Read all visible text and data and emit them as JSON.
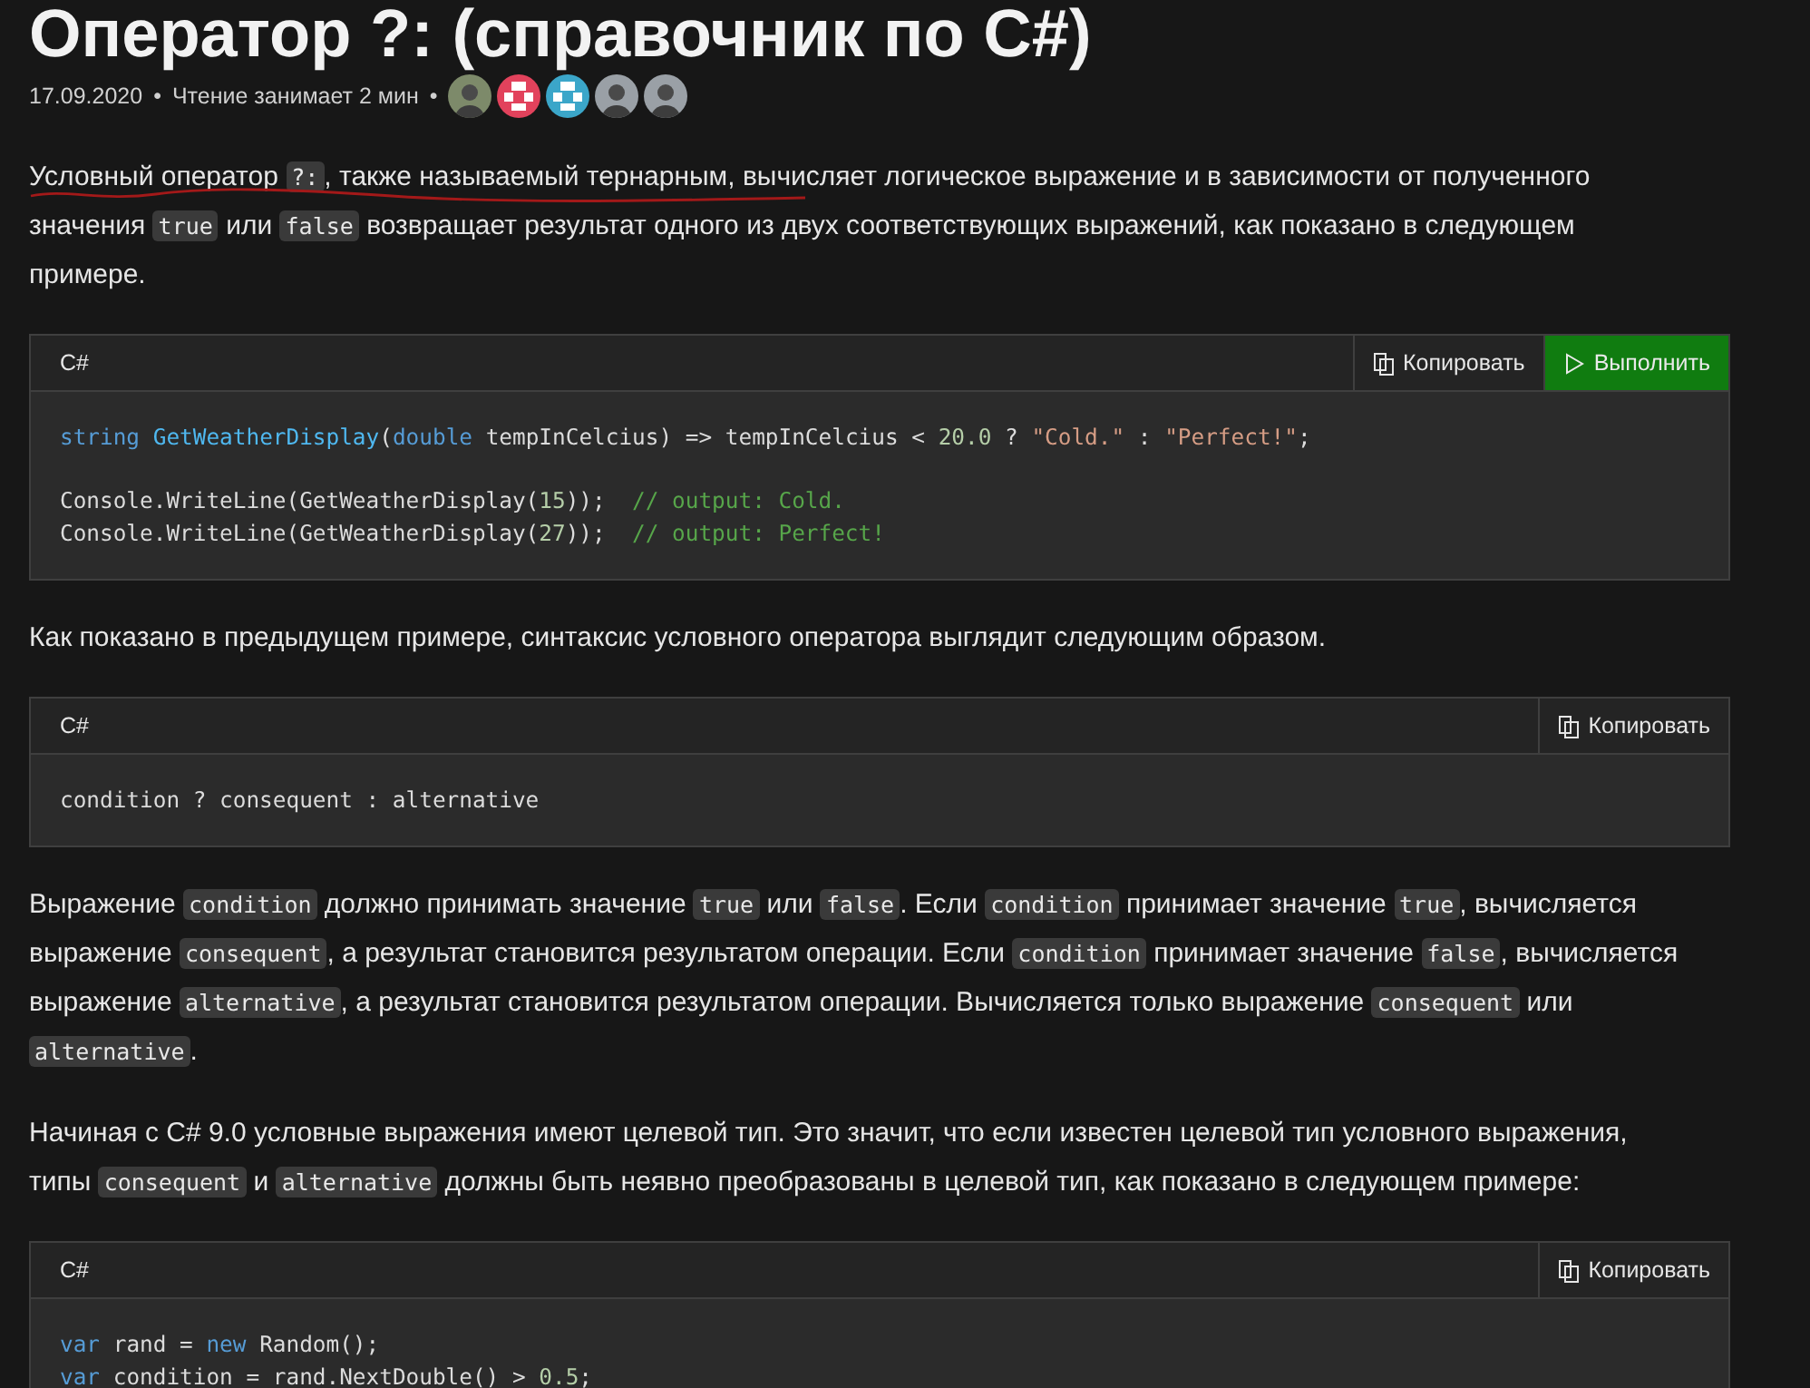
{
  "title": "Оператор ?: (справочник по C#)",
  "meta": {
    "date": "17.09.2020",
    "separator": "•",
    "reading_time": "Чтение занимает 2 мин",
    "separator_2": "•",
    "avatars": [
      {
        "kind": "photo"
      },
      {
        "kind": "identicon",
        "color": "#e2425c"
      },
      {
        "kind": "identicon",
        "color": "#3ba6c9"
      },
      {
        "kind": "photo"
      },
      {
        "kind": "photo"
      }
    ]
  },
  "content": [
    {
      "kind": "paragraph",
      "underlined": true,
      "segments": [
        {
          "kind": "text",
          "text": "Условный оператор "
        },
        {
          "kind": "code",
          "text": "?:"
        },
        {
          "kind": "text",
          "text": ", также называемый тернарным, вычисляет логическое выражение и в зависимости от полученного значения "
        },
        {
          "kind": "code",
          "text": "true"
        },
        {
          "kind": "text",
          "text": " или "
        },
        {
          "kind": "code",
          "text": "false"
        },
        {
          "kind": "text",
          "text": " возвращает результат одного из двух соответствующих выражений, как показано в следующем примере."
        }
      ]
    },
    {
      "kind": "code_block",
      "language": "C#",
      "buttons": [
        {
          "kind": "copy",
          "label": "Копировать"
        },
        {
          "kind": "run",
          "label": "Выполнить"
        }
      ],
      "groups": [
        [
          [
            {
              "kind": "keyword",
              "text": "string "
            },
            {
              "kind": "function",
              "text": "GetWeatherDisplay"
            },
            {
              "kind": "plain",
              "text": "("
            },
            {
              "kind": "keyword",
              "text": "double"
            },
            {
              "kind": "plain",
              "text": " tempInCelcius) => tempInCelcius < "
            },
            {
              "kind": "number",
              "text": "20.0"
            },
            {
              "kind": "plain",
              "text": " ? "
            },
            {
              "kind": "string",
              "text": "\"Cold.\""
            },
            {
              "kind": "plain",
              "text": " : "
            },
            {
              "kind": "string",
              "text": "\"Perfect!\""
            },
            {
              "kind": "plain",
              "text": ";"
            }
          ]
        ],
        [
          [
            {
              "kind": "plain",
              "text": "Console.WriteLine(GetWeatherDisplay("
            },
            {
              "kind": "number",
              "text": "15"
            },
            {
              "kind": "plain",
              "text": "));  "
            },
            {
              "kind": "comment",
              "text": "// output: Cold."
            }
          ],
          [
            {
              "kind": "plain",
              "text": "Console.WriteLine(GetWeatherDisplay("
            },
            {
              "kind": "number",
              "text": "27"
            },
            {
              "kind": "plain",
              "text": "));  "
            },
            {
              "kind": "comment",
              "text": "// output: Perfect!"
            }
          ]
        ]
      ]
    },
    {
      "kind": "paragraph",
      "underlined": false,
      "segments": [
        {
          "kind": "text",
          "text": "Как показано в предыдущем примере, синтаксис условного оператора выглядит следующим образом."
        }
      ]
    },
    {
      "kind": "code_block",
      "language": "C#",
      "buttons": [
        {
          "kind": "copy",
          "label": "Копировать"
        }
      ],
      "groups": [
        [
          [
            {
              "kind": "plain",
              "text": "condition ? consequent : alternative"
            }
          ]
        ]
      ]
    },
    {
      "kind": "paragraph",
      "underlined": false,
      "segments": [
        {
          "kind": "text",
          "text": "Выражение "
        },
        {
          "kind": "code",
          "text": "condition"
        },
        {
          "kind": "text",
          "text": " должно принимать значение "
        },
        {
          "kind": "code",
          "text": "true"
        },
        {
          "kind": "text",
          "text": " или "
        },
        {
          "kind": "code",
          "text": "false"
        },
        {
          "kind": "text",
          "text": ". Если "
        },
        {
          "kind": "code",
          "text": "condition"
        },
        {
          "kind": "text",
          "text": " принимает значение "
        },
        {
          "kind": "code",
          "text": "true"
        },
        {
          "kind": "text",
          "text": ", вычисляется выражение "
        },
        {
          "kind": "code",
          "text": "consequent"
        },
        {
          "kind": "text",
          "text": ", а результат становится результатом операции. Если "
        },
        {
          "kind": "code",
          "text": "condition"
        },
        {
          "kind": "text",
          "text": " принимает значение "
        },
        {
          "kind": "code",
          "text": "false"
        },
        {
          "kind": "text",
          "text": ", вычисляется выражение "
        },
        {
          "kind": "code",
          "text": "alternative"
        },
        {
          "kind": "text",
          "text": ", а результат становится результатом операции. Вычисляется только выражение "
        },
        {
          "kind": "code",
          "text": "consequent"
        },
        {
          "kind": "text",
          "text": " или "
        },
        {
          "kind": "code",
          "text": "alternative"
        },
        {
          "kind": "text",
          "text": "."
        }
      ]
    },
    {
      "kind": "paragraph",
      "underlined": false,
      "segments": [
        {
          "kind": "text",
          "text": "Начиная с C# 9.0 условные выражения имеют целевой тип. Это значит, что если известен целевой тип условного выражения, типы "
        },
        {
          "kind": "code",
          "text": "consequent"
        },
        {
          "kind": "text",
          "text": " и "
        },
        {
          "kind": "code",
          "text": "alternative"
        },
        {
          "kind": "text",
          "text": " должны быть неявно преобразованы в целевой тип, как показано в следующем примере:"
        }
      ]
    },
    {
      "kind": "code_block",
      "language": "C#",
      "buttons": [
        {
          "kind": "copy",
          "label": "Копировать"
        }
      ],
      "groups": [
        [
          [
            {
              "kind": "keyword",
              "text": "var"
            },
            {
              "kind": "plain",
              "text": " rand = "
            },
            {
              "kind": "keyword",
              "text": "new"
            },
            {
              "kind": "plain",
              "text": " Random();"
            }
          ],
          [
            {
              "kind": "keyword",
              "text": "var"
            },
            {
              "kind": "plain",
              "text": " condition = rand.NextDouble() > "
            },
            {
              "kind": "number",
              "text": "0.5"
            },
            {
              "kind": "plain",
              "text": ";"
            }
          ]
        ]
      ]
    }
  ]
}
